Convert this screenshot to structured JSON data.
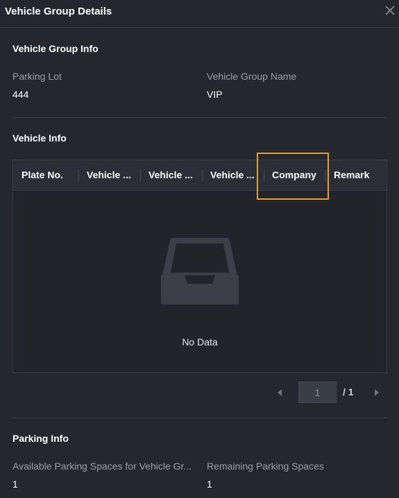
{
  "dialog": {
    "title": "Vehicle Group Details"
  },
  "group_info": {
    "title": "Vehicle Group Info",
    "parking_lot_label": "Parking Lot",
    "parking_lot_value": "444",
    "group_name_label": "Vehicle Group Name",
    "group_name_value": "VIP"
  },
  "vehicle_info": {
    "title": "Vehicle Info",
    "columns": [
      "Plate No.",
      "Vehicle ...",
      "Vehicle ...",
      "Vehicle ...",
      "Company",
      "Remark"
    ],
    "empty_text": "No Data",
    "highlight_color": "#e5a02d"
  },
  "pagination": {
    "current_page": "1",
    "total": "/ 1"
  },
  "parking_info": {
    "title": "Parking Info",
    "available_label": "Available Parking Spaces for Vehicle Gr...",
    "available_value": "1",
    "remaining_label": "Remaining Parking Spaces",
    "remaining_value": "1"
  }
}
